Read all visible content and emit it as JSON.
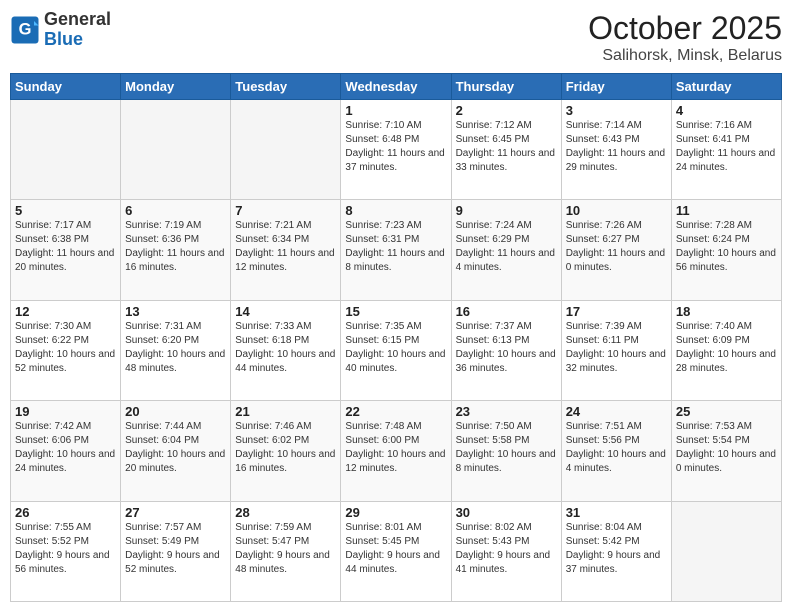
{
  "header": {
    "logo_line1": "General",
    "logo_line2": "Blue",
    "title": "October 2025",
    "subtitle": "Salihorsk, Minsk, Belarus"
  },
  "weekdays": [
    "Sunday",
    "Monday",
    "Tuesday",
    "Wednesday",
    "Thursday",
    "Friday",
    "Saturday"
  ],
  "weeks": [
    [
      {
        "day": "",
        "sunrise": "",
        "sunset": "",
        "daylight": ""
      },
      {
        "day": "",
        "sunrise": "",
        "sunset": "",
        "daylight": ""
      },
      {
        "day": "",
        "sunrise": "",
        "sunset": "",
        "daylight": ""
      },
      {
        "day": "1",
        "sunrise": "Sunrise: 7:10 AM",
        "sunset": "Sunset: 6:48 PM",
        "daylight": "Daylight: 11 hours and 37 minutes."
      },
      {
        "day": "2",
        "sunrise": "Sunrise: 7:12 AM",
        "sunset": "Sunset: 6:45 PM",
        "daylight": "Daylight: 11 hours and 33 minutes."
      },
      {
        "day": "3",
        "sunrise": "Sunrise: 7:14 AM",
        "sunset": "Sunset: 6:43 PM",
        "daylight": "Daylight: 11 hours and 29 minutes."
      },
      {
        "day": "4",
        "sunrise": "Sunrise: 7:16 AM",
        "sunset": "Sunset: 6:41 PM",
        "daylight": "Daylight: 11 hours and 24 minutes."
      }
    ],
    [
      {
        "day": "5",
        "sunrise": "Sunrise: 7:17 AM",
        "sunset": "Sunset: 6:38 PM",
        "daylight": "Daylight: 11 hours and 20 minutes."
      },
      {
        "day": "6",
        "sunrise": "Sunrise: 7:19 AM",
        "sunset": "Sunset: 6:36 PM",
        "daylight": "Daylight: 11 hours and 16 minutes."
      },
      {
        "day": "7",
        "sunrise": "Sunrise: 7:21 AM",
        "sunset": "Sunset: 6:34 PM",
        "daylight": "Daylight: 11 hours and 12 minutes."
      },
      {
        "day": "8",
        "sunrise": "Sunrise: 7:23 AM",
        "sunset": "Sunset: 6:31 PM",
        "daylight": "Daylight: 11 hours and 8 minutes."
      },
      {
        "day": "9",
        "sunrise": "Sunrise: 7:24 AM",
        "sunset": "Sunset: 6:29 PM",
        "daylight": "Daylight: 11 hours and 4 minutes."
      },
      {
        "day": "10",
        "sunrise": "Sunrise: 7:26 AM",
        "sunset": "Sunset: 6:27 PM",
        "daylight": "Daylight: 11 hours and 0 minutes."
      },
      {
        "day": "11",
        "sunrise": "Sunrise: 7:28 AM",
        "sunset": "Sunset: 6:24 PM",
        "daylight": "Daylight: 10 hours and 56 minutes."
      }
    ],
    [
      {
        "day": "12",
        "sunrise": "Sunrise: 7:30 AM",
        "sunset": "Sunset: 6:22 PM",
        "daylight": "Daylight: 10 hours and 52 minutes."
      },
      {
        "day": "13",
        "sunrise": "Sunrise: 7:31 AM",
        "sunset": "Sunset: 6:20 PM",
        "daylight": "Daylight: 10 hours and 48 minutes."
      },
      {
        "day": "14",
        "sunrise": "Sunrise: 7:33 AM",
        "sunset": "Sunset: 6:18 PM",
        "daylight": "Daylight: 10 hours and 44 minutes."
      },
      {
        "day": "15",
        "sunrise": "Sunrise: 7:35 AM",
        "sunset": "Sunset: 6:15 PM",
        "daylight": "Daylight: 10 hours and 40 minutes."
      },
      {
        "day": "16",
        "sunrise": "Sunrise: 7:37 AM",
        "sunset": "Sunset: 6:13 PM",
        "daylight": "Daylight: 10 hours and 36 minutes."
      },
      {
        "day": "17",
        "sunrise": "Sunrise: 7:39 AM",
        "sunset": "Sunset: 6:11 PM",
        "daylight": "Daylight: 10 hours and 32 minutes."
      },
      {
        "day": "18",
        "sunrise": "Sunrise: 7:40 AM",
        "sunset": "Sunset: 6:09 PM",
        "daylight": "Daylight: 10 hours and 28 minutes."
      }
    ],
    [
      {
        "day": "19",
        "sunrise": "Sunrise: 7:42 AM",
        "sunset": "Sunset: 6:06 PM",
        "daylight": "Daylight: 10 hours and 24 minutes."
      },
      {
        "day": "20",
        "sunrise": "Sunrise: 7:44 AM",
        "sunset": "Sunset: 6:04 PM",
        "daylight": "Daylight: 10 hours and 20 minutes."
      },
      {
        "day": "21",
        "sunrise": "Sunrise: 7:46 AM",
        "sunset": "Sunset: 6:02 PM",
        "daylight": "Daylight: 10 hours and 16 minutes."
      },
      {
        "day": "22",
        "sunrise": "Sunrise: 7:48 AM",
        "sunset": "Sunset: 6:00 PM",
        "daylight": "Daylight: 10 hours and 12 minutes."
      },
      {
        "day": "23",
        "sunrise": "Sunrise: 7:50 AM",
        "sunset": "Sunset: 5:58 PM",
        "daylight": "Daylight: 10 hours and 8 minutes."
      },
      {
        "day": "24",
        "sunrise": "Sunrise: 7:51 AM",
        "sunset": "Sunset: 5:56 PM",
        "daylight": "Daylight: 10 hours and 4 minutes."
      },
      {
        "day": "25",
        "sunrise": "Sunrise: 7:53 AM",
        "sunset": "Sunset: 5:54 PM",
        "daylight": "Daylight: 10 hours and 0 minutes."
      }
    ],
    [
      {
        "day": "26",
        "sunrise": "Sunrise: 7:55 AM",
        "sunset": "Sunset: 5:52 PM",
        "daylight": "Daylight: 9 hours and 56 minutes."
      },
      {
        "day": "27",
        "sunrise": "Sunrise: 7:57 AM",
        "sunset": "Sunset: 5:49 PM",
        "daylight": "Daylight: 9 hours and 52 minutes."
      },
      {
        "day": "28",
        "sunrise": "Sunrise: 7:59 AM",
        "sunset": "Sunset: 5:47 PM",
        "daylight": "Daylight: 9 hours and 48 minutes."
      },
      {
        "day": "29",
        "sunrise": "Sunrise: 8:01 AM",
        "sunset": "Sunset: 5:45 PM",
        "daylight": "Daylight: 9 hours and 44 minutes."
      },
      {
        "day": "30",
        "sunrise": "Sunrise: 8:02 AM",
        "sunset": "Sunset: 5:43 PM",
        "daylight": "Daylight: 9 hours and 41 minutes."
      },
      {
        "day": "31",
        "sunrise": "Sunrise: 8:04 AM",
        "sunset": "Sunset: 5:42 PM",
        "daylight": "Daylight: 9 hours and 37 minutes."
      },
      {
        "day": "",
        "sunrise": "",
        "sunset": "",
        "daylight": ""
      }
    ]
  ]
}
